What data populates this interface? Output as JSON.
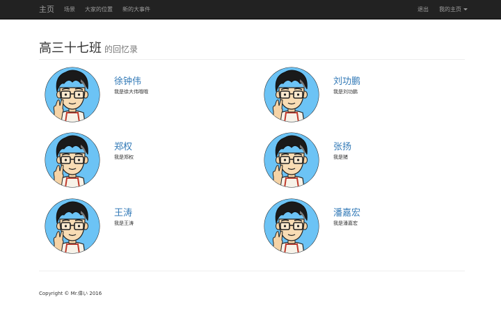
{
  "navbar": {
    "brand": "主页",
    "links": [
      "场景",
      "大家的位置",
      "新的大事件"
    ],
    "logout": "退出",
    "my_home": "我的主页"
  },
  "header": {
    "title": "高三十七班",
    "subtitle": "的回忆录"
  },
  "members": [
    {
      "name": "徐钟伟",
      "desc": "我是徐大伟哦哦"
    },
    {
      "name": "刘功鹏",
      "desc": "我是刘功鹏"
    },
    {
      "name": "郑权",
      "desc": "我是郑权"
    },
    {
      "name": "张扬",
      "desc": "我是猪"
    },
    {
      "name": "王涛",
      "desc": "我是王涛"
    },
    {
      "name": "潘嘉宏",
      "desc": "我是潘嘉宏"
    }
  ],
  "footer": {
    "copyright": "Copyright © Mr.偉い 2016"
  },
  "colors": {
    "navbar_bg": "#222222",
    "link": "#337ab7",
    "avatar_bg": "#6cc3f5"
  },
  "icons": {
    "avatar": "cartoon-boy-avatar-icon",
    "dropdown": "caret-down-icon"
  }
}
